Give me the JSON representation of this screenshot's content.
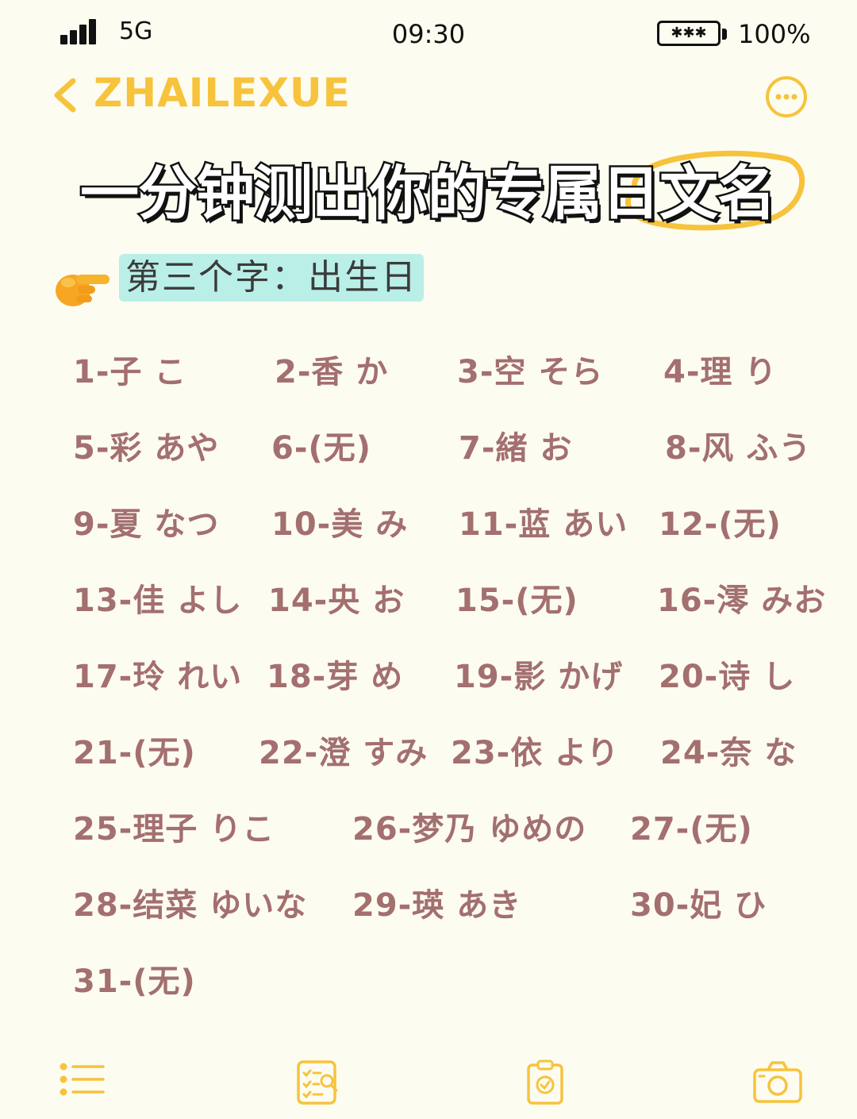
{
  "status": {
    "network": "5G",
    "time": "09:30",
    "battery_text": "100%"
  },
  "nav": {
    "title": "ZHAILEXUE",
    "back_icon": "chevron-left-icon",
    "more_icon": "more-dots-icon"
  },
  "headline": "一分钟测出你的专属日文名",
  "section": {
    "label": "第三个字：出生日",
    "icon": "pointing-hand-icon"
  },
  "names": [
    "1-子 こ",
    "2-香 か",
    "3-空 そら",
    "4-理 り",
    "5-彩 あや",
    "6-(无)",
    "7-緒 お",
    "8-风 ふう",
    "9-夏 なつ",
    "10-美 み",
    "11-蓝 あい",
    "12-(无)",
    "13-佳 よし",
    "14-央 お",
    "15-(无)",
    "16-澪 みお",
    "17-玲 れい",
    "18-芽 め",
    "19-影 かげ",
    "20-诗 し",
    "21-(无)",
    "22-澄 すみ",
    "23-依 より",
    "24-奈 な",
    "25-理子 りこ",
    "26-梦乃 ゆめの",
    "27-(无)",
    "28-结菜 ゆいな",
    "29-瑛 あき",
    "30-妃 ひ",
    "31-(无)"
  ],
  "tabbar": [
    "list-icon",
    "checklist-search-icon",
    "clipboard-check-icon",
    "camera-icon"
  ],
  "colors": {
    "background": "#fdfcf1",
    "accent": "#f7c33c",
    "name_text": "#a36f6f",
    "label_bg": "#b9efe7"
  }
}
